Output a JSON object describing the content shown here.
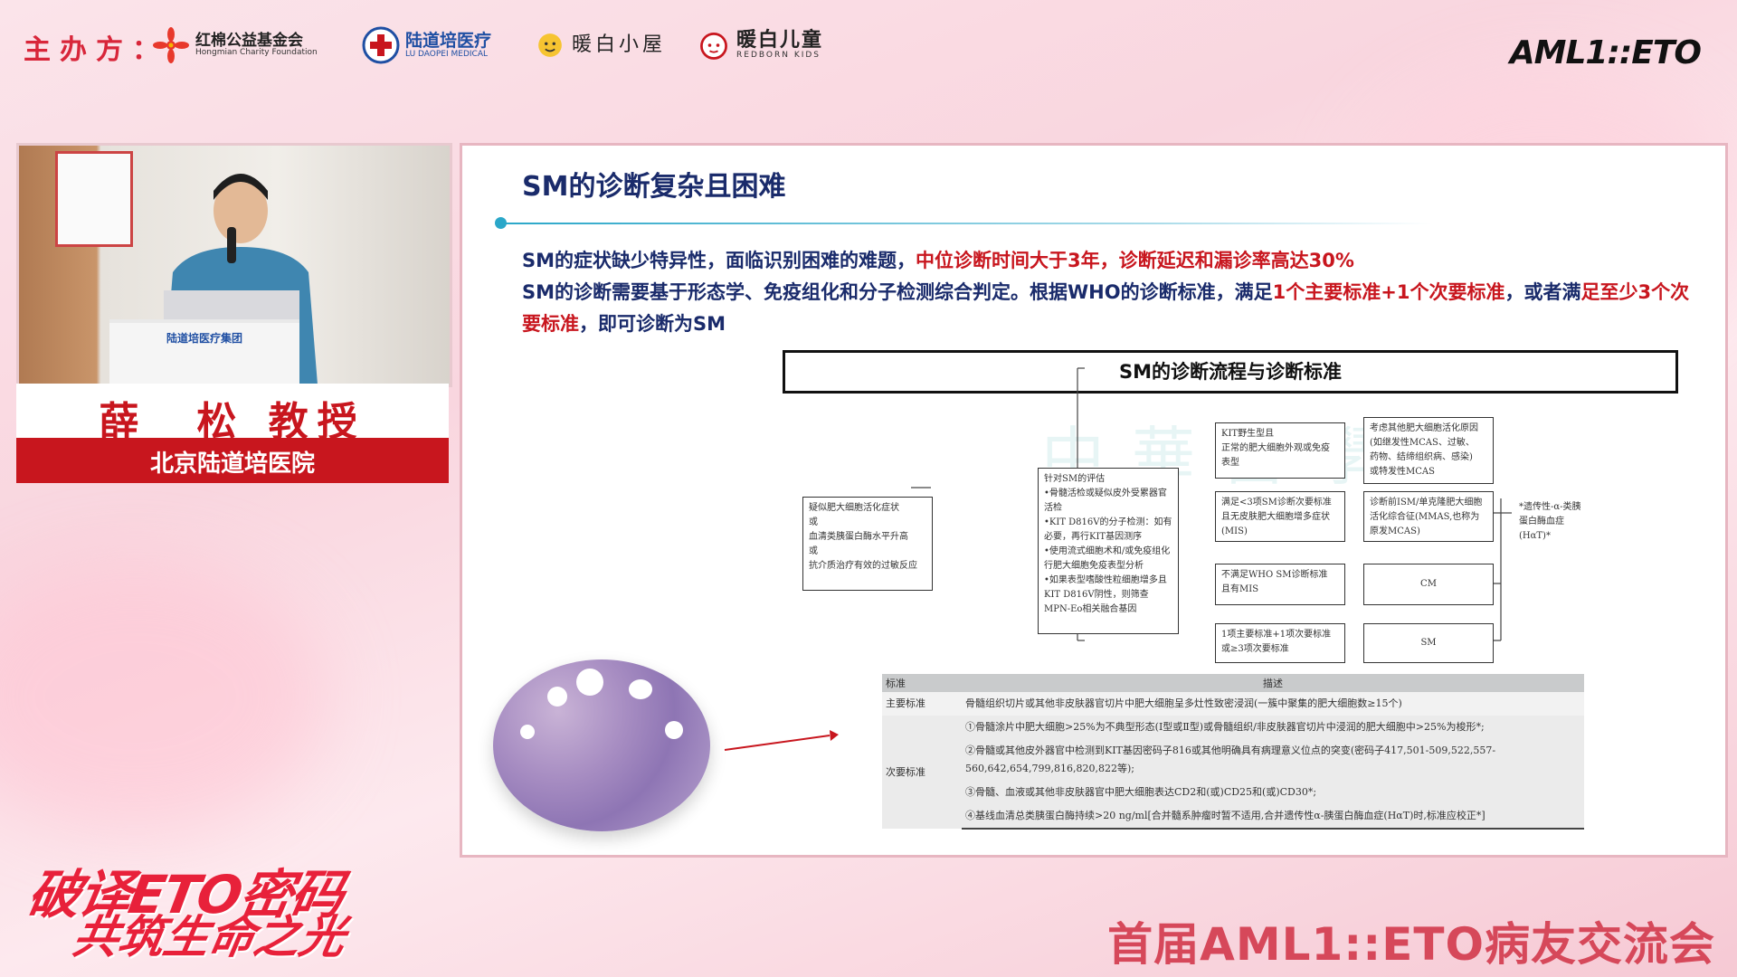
{
  "header": {
    "organizer_label": "主办方：",
    "logos": [
      {
        "name": "红棉公益基金会",
        "sub": "Hongmian Charity Foundation"
      },
      {
        "name": "陆道培医疗",
        "sub": "LU DAOPEI MEDICAL"
      },
      {
        "name": "暖白小屋",
        "sub": ""
      },
      {
        "name": "暖白儿童",
        "sub": "REDBORN KIDS"
      }
    ],
    "brand": "AML1::ETO"
  },
  "speaker": {
    "name": "薛　松 教授",
    "hospital": "北京陆道培医院",
    "podium_label": "陆道培医疗集团"
  },
  "slide": {
    "title": "SM的诊断复杂且困难",
    "bullet1": {
      "normal": "SM的症状缺少特异性，面临识别困难的难题，",
      "red": "中位诊断时间大于3年，诊断延迟和漏诊率高达30%"
    },
    "bullet2": {
      "part1": "SM的诊断需要基于形态学、免疫组化和分子检测综合判定。根据WHO的诊断标准，满足",
      "red1": "1个主要标准+1个次要标准",
      "part2": "，或者满",
      "red2": "足至少3个次要标准",
      "part3": "，即可诊断为SM"
    },
    "box_title": "SM的诊断流程与诊断标准",
    "watermark": "中華醫學會",
    "flowchart": {
      "start": "疑似肥大细胞活化症状\n或\n血清类胰蛋白酶水平升高\n或\n抗介质治疗有效的过敏反应",
      "eval": "针对SM的评估\n•骨髓活检或疑似皮外受累器官活检\n•KIT D816V的分子检测：如有必要，再行KIT基因测序\n•使用流式细胞术和/或免疫组化行肥大细胞免疫表型分析\n•如果表型嗜酸性粒细胞增多且KIT D816V阴性，则筛查MPN-Eo相关融合基因",
      "branch1": "KIT野生型且\n正常的肥大细胞外观或免疫\n表型",
      "branch2": "满足<3项SM诊断次要标准\n且无皮肤肥大细胞增多症状\n(MIS)",
      "branch3": "不满足WHO SM诊断标准\n且有MIS",
      "branch4": "1项主要标准+1项次要标准\n或≥3项次要标准",
      "out1": "考虑其他肥大细胞活化原因\n(如继发性MCAS、过敏、\n药物、结缔组织病、感染)\n或特发性MCAS",
      "out2": "诊断前ISM/单克隆肥大细胞\n活化综合征(MMAS,也称为\n原发MCAS)",
      "out3": "CM",
      "out4": "SM",
      "note": "*遗传性-α-类胰蛋白酶血症(HαT)*"
    },
    "table": {
      "headers": [
        "标准",
        "描述"
      ],
      "major_label": "主要标准",
      "major_desc": "骨髓组织切片或其他非皮肤器官切片中肥大细胞呈多灶性致密浸润(一簇中聚集的肥大细胞数≥15个)",
      "minor_label": "次要标准",
      "minor_items": [
        "①骨髓涂片中肥大细胞>25%为不典型形态(Ⅰ型或Ⅱ型)或骨髓组织/非皮肤器官切片中浸润的肥大细胞中>25%为梭形*;",
        "②骨髓或其他皮外器官中检测到KIT基因密码子816或其他明确具有病理意义位点的突变(密码子417,501-509,522,557-560,642,654,799,816,820,822等);",
        "③骨髓、血液或其他非皮肤器官中肥大细胞表达CD2和(或)CD25和(或)CD30*;",
        "④基线血清总类胰蛋白酶持续>20 ng/ml[合并髓系肿瘤时暂不适用,合并遗传性α-胰蛋白酶血症(HαT)时,标准应校正*]"
      ]
    }
  },
  "footer": {
    "campaign_line1": "破译ETO密码",
    "campaign_line2": "共筑生命之光",
    "event_title": "首届AML1::ETO病友交流会"
  },
  "colors": {
    "accent_red": "#c8161e",
    "title_navy": "#1a2b6b",
    "line_teal": "#2aa7c9"
  }
}
